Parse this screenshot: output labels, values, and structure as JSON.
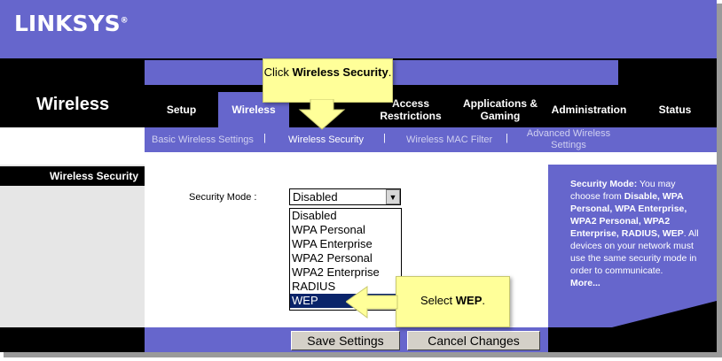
{
  "brand": {
    "logo": "LINKSYS",
    "reg": "®"
  },
  "section_title": "Wireless",
  "tabs": [
    {
      "label": "Setup"
    },
    {
      "label": "Wireless"
    },
    {
      "label": "Access Restrictions"
    },
    {
      "label": "Applications & Gaming"
    },
    {
      "label": "Administration"
    },
    {
      "label": "Status"
    }
  ],
  "subnav": {
    "items": [
      "Basic Wireless Settings",
      "Wireless Security",
      "Wireless MAC Filter",
      "Advanced Wireless Settings"
    ],
    "separator": "|"
  },
  "left_label": "Wireless Security",
  "form": {
    "security_mode_label": "Security Mode :",
    "selected_value": "Disabled",
    "options": [
      "Disabled",
      "WPA Personal",
      "WPA Enterprise",
      "WPA2 Personal",
      "WPA2 Enterprise",
      "RADIUS",
      "WEP"
    ],
    "highlighted_option": "WEP"
  },
  "help": {
    "lead": "Security Mode:",
    "text1": " You may choose from ",
    "b1": "Disable, WPA Personal, WPA Enterprise, WPA2 Personal, WPA2 Enterprise, RADIUS, WEP",
    "text2": ". All devices on your network must use the same security mode in order to communicate.",
    "more": "More..."
  },
  "buttons": {
    "save": "Save Settings",
    "cancel": "Cancel Changes"
  },
  "callouts": {
    "click_prefix": "Click ",
    "click_bold": "Wireless Security",
    "click_suffix": ".",
    "select_prefix": "Select ",
    "select_bold": "WEP",
    "select_suffix": "."
  },
  "colors": {
    "purple": "#6666cc",
    "black": "#000000",
    "callout": "#ffff99",
    "selection": "#0a246a"
  }
}
